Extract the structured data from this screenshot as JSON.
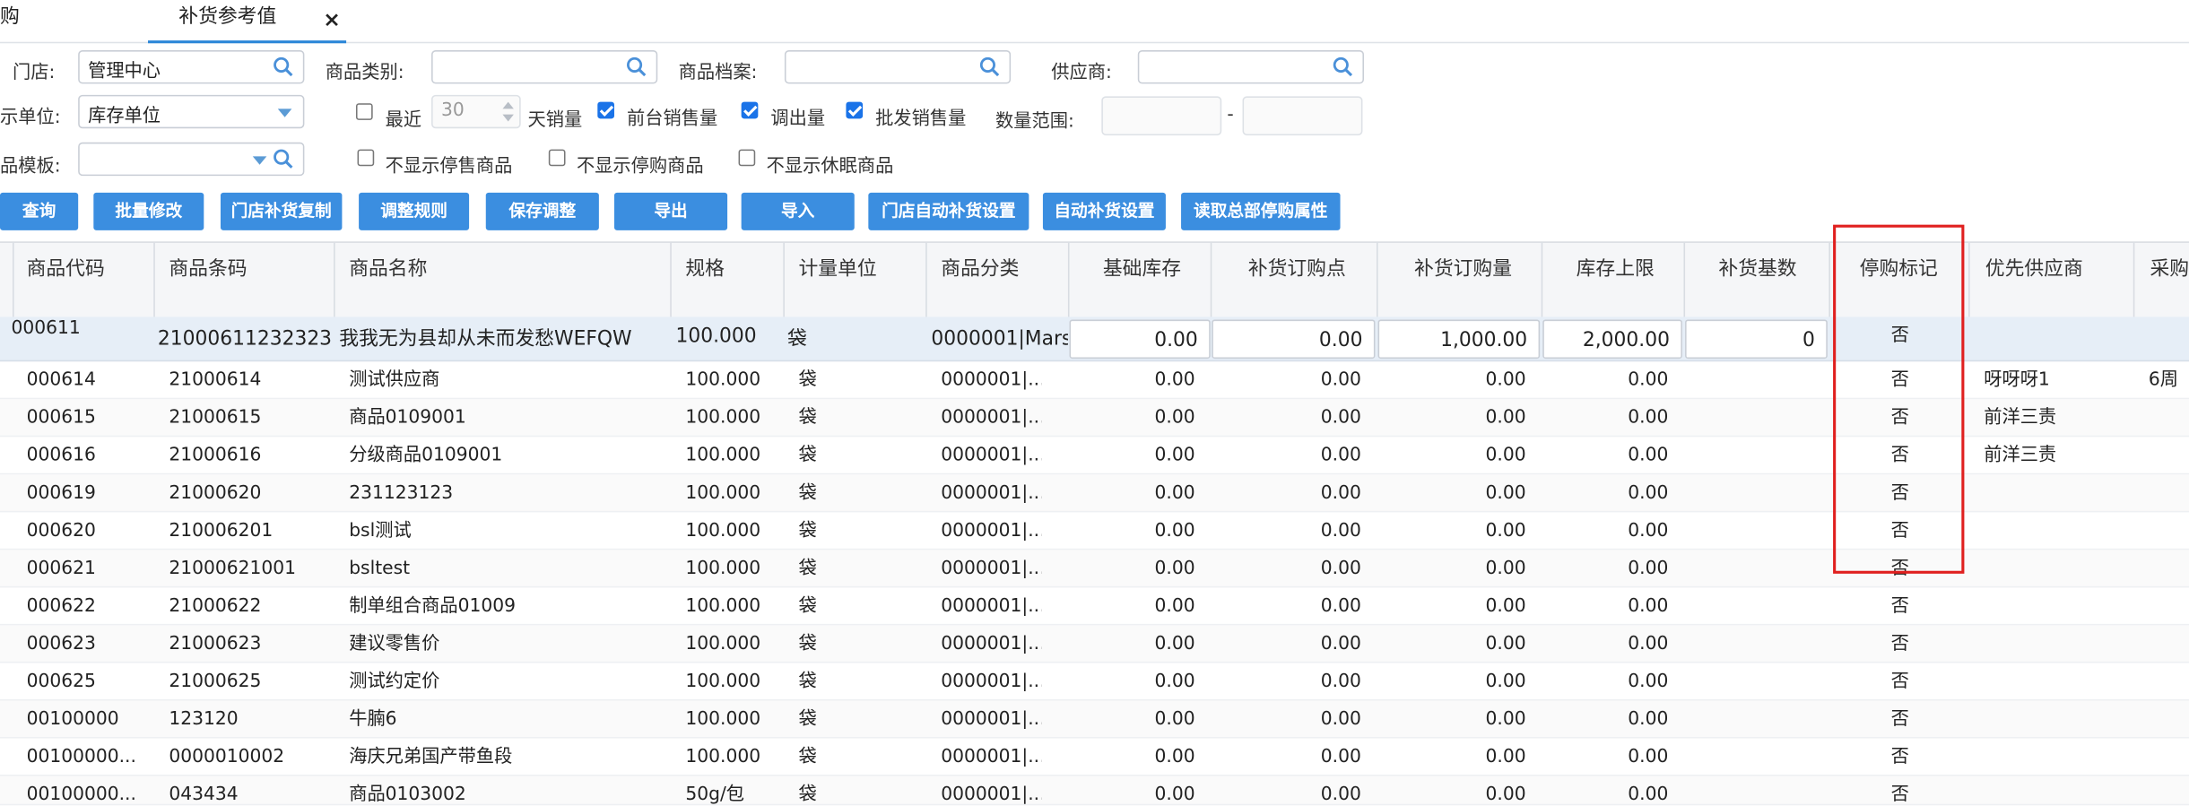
{
  "tabs": {
    "prev_label": "购",
    "active_label": "补货参考值",
    "close_glyph": "×"
  },
  "filters": {
    "store_label": "门店:",
    "store_value": "管理中心",
    "category_label": "商品类别:",
    "category_value": "",
    "archive_label": "商品档案:",
    "archive_value": "",
    "supplier_label": "供应商:",
    "supplier_value": "",
    "unit_label": "示单位:",
    "unit_value": "库存单位",
    "recent_label": "最近",
    "recent_days": "30",
    "days_sales_label": "天销量",
    "front_sales_label": "前台销售量",
    "front_sales_checked": true,
    "transfer_out_label": "调出量",
    "transfer_out_checked": true,
    "wholesale_label": "批发销售量",
    "wholesale_checked": true,
    "qty_range_label": "数量范围:",
    "qty_range_sep": "-",
    "template_label": "品模板:",
    "template_value": "",
    "hide_stop_sale_label": "不显示停售商品",
    "hide_stop_purchase_label": "不显示停购商品",
    "hide_dormant_label": "不显示休眠商品"
  },
  "toolbar": {
    "query": "查询",
    "batch_edit": "批量修改",
    "store_copy": "门店补货复制",
    "adjust_rules": "调整规则",
    "save_adjust": "保存调整",
    "export": "导出",
    "import": "导入",
    "store_auto_setting": "门店自动补货设置",
    "auto_setting": "自动补货设置",
    "read_hq_stop": "读取总部停购属性"
  },
  "columns": [
    "商品代码",
    "商品条码",
    "商品名称",
    "规格",
    "计量单位",
    "商品分类",
    "基础库存",
    "补货订购点",
    "补货订购量",
    "库存上限",
    "补货基数",
    "停购标记",
    "优先供应商",
    "采购"
  ],
  "selected_row": {
    "code": "000611",
    "barcode": "21000611232323",
    "name": "我我无为县却从未而发愁WEFQW",
    "spec": "100.000",
    "unit": "袋",
    "category": "0000001|Mars",
    "base_stock": "0.00",
    "reorder_point": "0.00",
    "reorder_qty": "1,000.00",
    "stock_max": "2,000.00",
    "reorder_base": "0",
    "stop_flag": "否",
    "supplier": "",
    "cycle": ""
  },
  "rows": [
    {
      "code": "000614",
      "barcode": "21000614",
      "name": "测试供应商",
      "spec": "100.000",
      "unit": "袋",
      "category": "0000001|...",
      "base": "0.00",
      "point": "0.00",
      "qty": "0.00",
      "max": "0.00",
      "stop": "否",
      "supplier": "呀呀呀1",
      "cycle": "6周"
    },
    {
      "code": "000615",
      "barcode": "21000615",
      "name": "商品0109001",
      "spec": "100.000",
      "unit": "袋",
      "category": "0000001|...",
      "base": "0.00",
      "point": "0.00",
      "qty": "0.00",
      "max": "0.00",
      "stop": "否",
      "supplier": "前洋三责",
      "cycle": ""
    },
    {
      "code": "000616",
      "barcode": "21000616",
      "name": "分级商品0109001",
      "spec": "100.000",
      "unit": "袋",
      "category": "0000001|...",
      "base": "0.00",
      "point": "0.00",
      "qty": "0.00",
      "max": "0.00",
      "stop": "否",
      "supplier": "前洋三责",
      "cycle": ""
    },
    {
      "code": "000619",
      "barcode": "21000620",
      "name": "231123123",
      "spec": "100.000",
      "unit": "袋",
      "category": "0000001|...",
      "base": "0.00",
      "point": "0.00",
      "qty": "0.00",
      "max": "0.00",
      "stop": "否",
      "supplier": "",
      "cycle": ""
    },
    {
      "code": "000620",
      "barcode": "210006201",
      "name": "bsl测试",
      "spec": "100.000",
      "unit": "袋",
      "category": "0000001|...",
      "base": "0.00",
      "point": "0.00",
      "qty": "0.00",
      "max": "0.00",
      "stop": "否",
      "supplier": "",
      "cycle": ""
    },
    {
      "code": "000621",
      "barcode": "21000621001",
      "name": "bsltest",
      "spec": "100.000",
      "unit": "袋",
      "category": "0000001|...",
      "base": "0.00",
      "point": "0.00",
      "qty": "0.00",
      "max": "0.00",
      "stop": "否",
      "supplier": "",
      "cycle": ""
    },
    {
      "code": "000622",
      "barcode": "21000622",
      "name": "制单组合商品01009",
      "spec": "100.000",
      "unit": "袋",
      "category": "0000001|...",
      "base": "0.00",
      "point": "0.00",
      "qty": "0.00",
      "max": "0.00",
      "stop": "否",
      "supplier": "",
      "cycle": ""
    },
    {
      "code": "000623",
      "barcode": "21000623",
      "name": "建议零售价",
      "spec": "100.000",
      "unit": "袋",
      "category": "0000001|...",
      "base": "0.00",
      "point": "0.00",
      "qty": "0.00",
      "max": "0.00",
      "stop": "否",
      "supplier": "",
      "cycle": ""
    },
    {
      "code": "000625",
      "barcode": "21000625",
      "name": "测试约定价",
      "spec": "100.000",
      "unit": "袋",
      "category": "0000001|...",
      "base": "0.00",
      "point": "0.00",
      "qty": "0.00",
      "max": "0.00",
      "stop": "否",
      "supplier": "",
      "cycle": ""
    },
    {
      "code": "00100000",
      "barcode": "123120",
      "name": "牛腩6",
      "spec": "100.000",
      "unit": "袋",
      "category": "0000001|...",
      "base": "0.00",
      "point": "0.00",
      "qty": "0.00",
      "max": "0.00",
      "stop": "否",
      "supplier": "",
      "cycle": ""
    },
    {
      "code": "00100000...",
      "barcode": "0000010002",
      "name": "海庆兄弟国产带鱼段",
      "spec": "100.000",
      "unit": "袋",
      "category": "0000001|...",
      "base": "0.00",
      "point": "0.00",
      "qty": "0.00",
      "max": "0.00",
      "stop": "否",
      "supplier": "",
      "cycle": ""
    },
    {
      "code": "00100000...",
      "barcode": "043434",
      "name": "商品0103002",
      "spec": "50g/包",
      "unit": "袋",
      "category": "0000001|...",
      "base": "0.00",
      "point": "0.00",
      "qty": "0.00",
      "max": "0.00",
      "stop": "否",
      "supplier": "",
      "cycle": ""
    }
  ],
  "icons": {
    "search": "search-icon",
    "dropdown": "chevron-down-icon",
    "close": "close-icon"
  },
  "colors": {
    "button": "#3b8ee0",
    "highlight_box": "#e0201f",
    "selected_row": "#e6eef7",
    "active_tab_border": "#2b86d8"
  }
}
